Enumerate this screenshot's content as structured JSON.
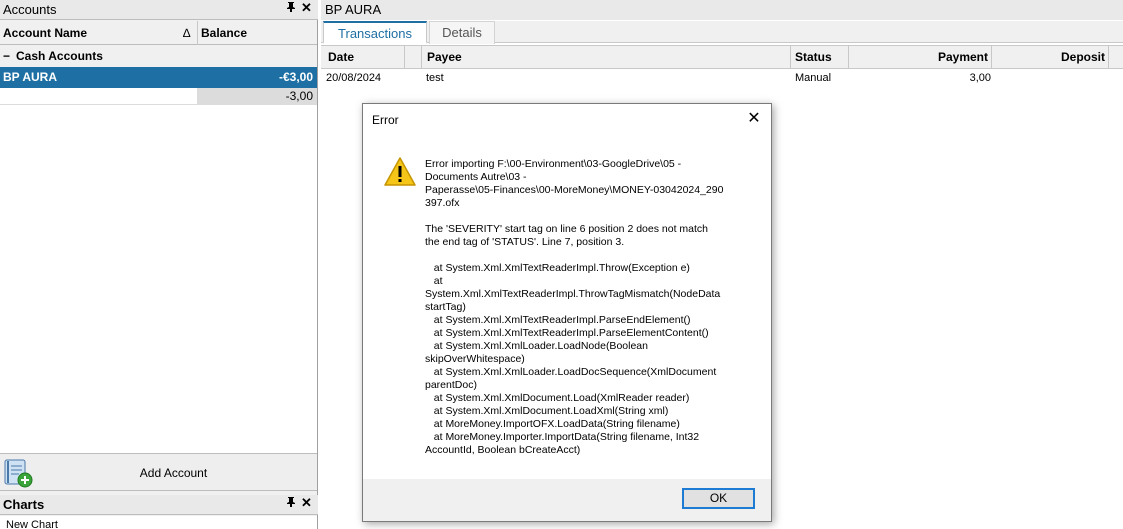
{
  "accounts_pane": {
    "title": "Accounts",
    "pin_icon": "pin-icon",
    "close_icon": "close-icon",
    "columns": {
      "name": "Account Name",
      "balance": "Balance",
      "sort_indicator": "∆"
    },
    "group": {
      "toggle": "−",
      "label": "Cash Accounts"
    },
    "selected_account": {
      "name": "BP AURA",
      "balance": "-€3,00"
    },
    "sub_balance": "-3,00",
    "add_account_label": "Add Account"
  },
  "charts_pane": {
    "title": "Charts",
    "item": "New Chart"
  },
  "register": {
    "title": "BP AURA",
    "tabs": [
      {
        "label": "Transactions",
        "active": true
      },
      {
        "label": "Details",
        "active": false
      }
    ],
    "columns": {
      "date": "Date",
      "payee": "Payee",
      "status": "Status",
      "payment": "Payment",
      "deposit": "Deposit"
    },
    "rows": [
      {
        "date": "20/08/2024",
        "payee": "test",
        "status": "Manual",
        "payment": "3,00",
        "deposit": ""
      }
    ]
  },
  "dialog": {
    "title": "Error",
    "message": "Error importing F:\\00-Environment\\03-GoogleDrive\\05 -\nDocuments Autre\\03 -\nPaperasse\\05-Finances\\00-MoreMoney\\MONEY-03042024_290\n397.ofx\n\nThe 'SEVERITY' start tag on line 6 position 2 does not match\nthe end tag of 'STATUS'. Line 7, position 3.\n\n   at System.Xml.XmlTextReaderImpl.Throw(Exception e)\n   at\nSystem.Xml.XmlTextReaderImpl.ThrowTagMismatch(NodeData\nstartTag)\n   at System.Xml.XmlTextReaderImpl.ParseEndElement()\n   at System.Xml.XmlTextReaderImpl.ParseElementContent()\n   at System.Xml.XmlLoader.LoadNode(Boolean\nskipOverWhitespace)\n   at System.Xml.XmlLoader.LoadDocSequence(XmlDocument\nparentDoc)\n   at System.Xml.XmlDocument.Load(XmlReader reader)\n   at System.Xml.XmlDocument.LoadXml(String xml)\n   at MoreMoney.ImportOFX.LoadData(String filename)\n   at MoreMoney.Importer.ImportData(String filename, Int32\nAccountId, Boolean bCreateAcct)",
    "ok_label": "OK",
    "icon": "warning-icon"
  },
  "colors": {
    "selection": "#1e6fa3",
    "tab_accent": "#1e6fa3",
    "ok_border": "#1e7bd4",
    "warning_fill": "#f5c518"
  }
}
